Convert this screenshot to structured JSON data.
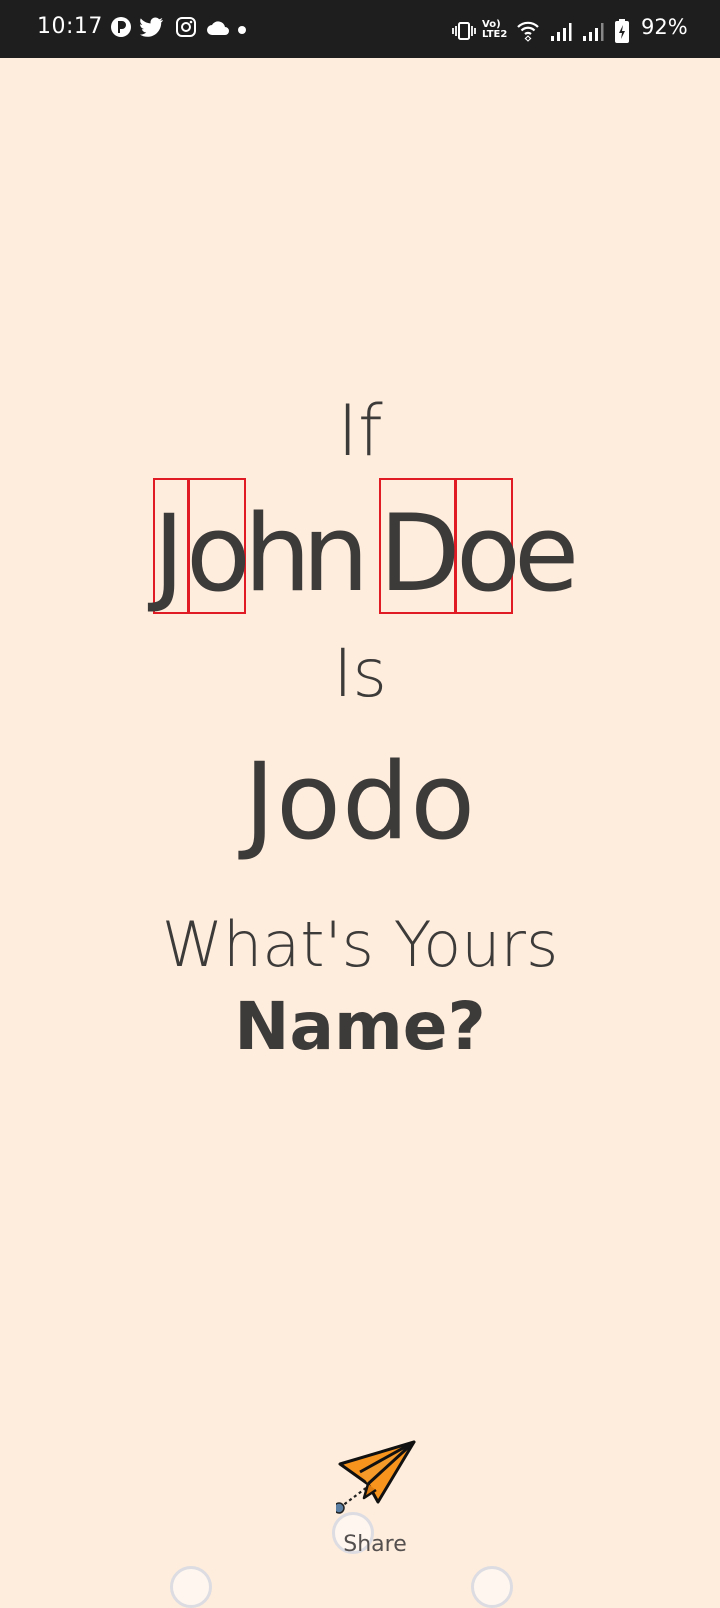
{
  "status_bar": {
    "time": "10:17",
    "battery": "92%",
    "network_label": "Vo) LTE2",
    "left_icons": [
      "tumblr-like-icon",
      "twitter-icon",
      "instagram-icon",
      "cloud-icon",
      "dot-icon"
    ],
    "right_icons": [
      "vibrate-icon",
      "volte-icon",
      "wifi-icon",
      "signal-icon",
      "signal-icon",
      "battery-charging-icon"
    ]
  },
  "content": {
    "line_if": "If",
    "full_name_chars": [
      "J",
      "o",
      "h",
      "n",
      " ",
      "D",
      "o",
      "e"
    ],
    "line_is": "Is",
    "nickname": "Jodo",
    "line_question": "What's Yours",
    "line_name": "Name?"
  },
  "share": {
    "label": "Share",
    "icon": "paper-plane-icon"
  },
  "colors": {
    "background": "#feeddc",
    "text": "#3d3a3a",
    "highlight_box": "#e01b24",
    "plane_orange": "#f7941d",
    "status_bar": "#1e1e1e"
  }
}
